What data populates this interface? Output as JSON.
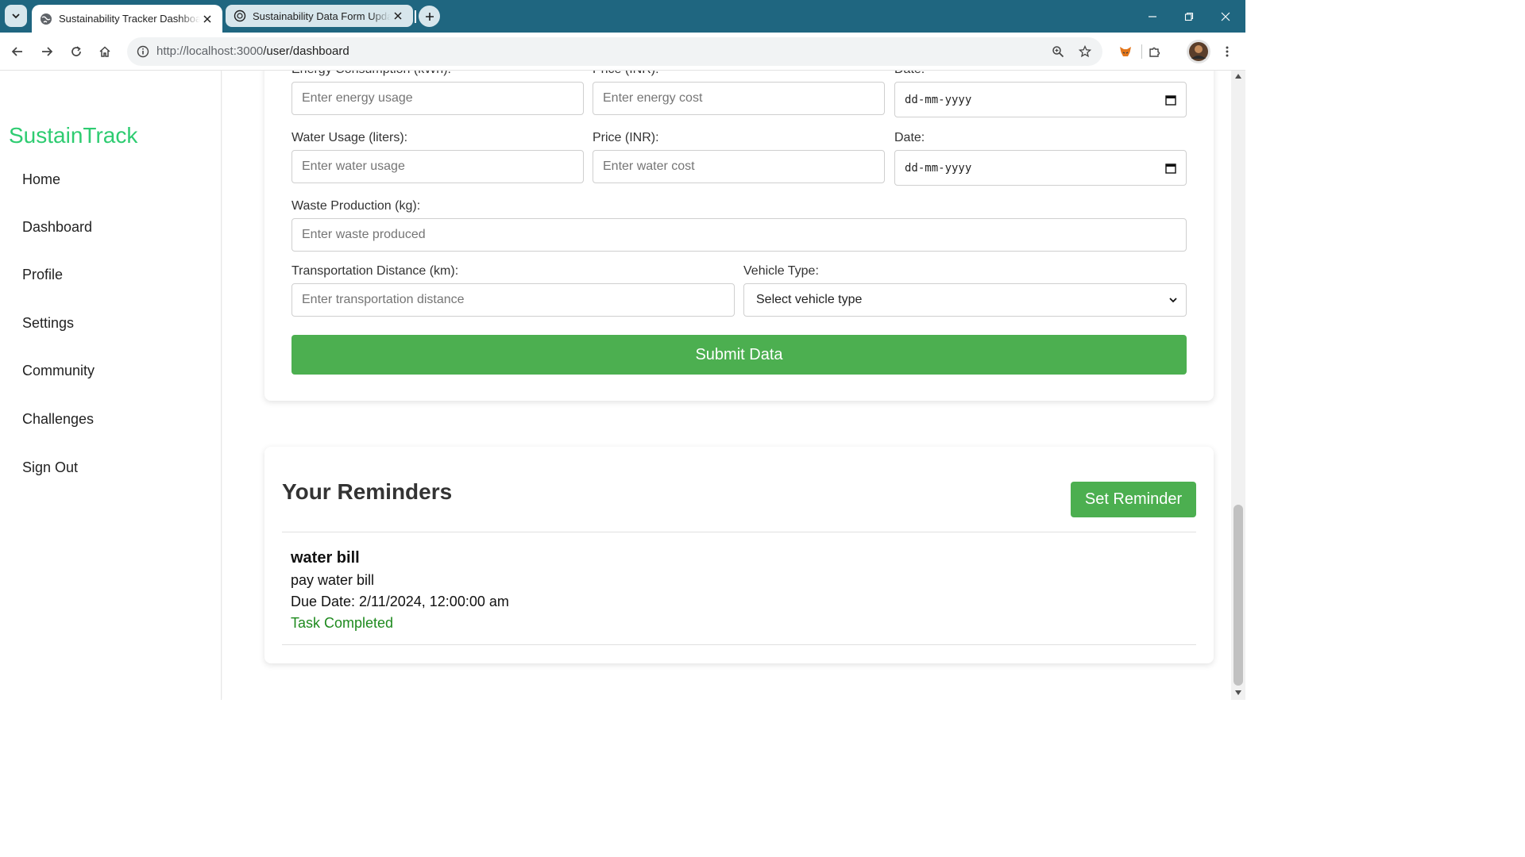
{
  "browser": {
    "tabs": [
      {
        "title": "Sustainability Tracker Dashboard",
        "active": true
      },
      {
        "title": "Sustainability Data Form Update",
        "active": false
      }
    ],
    "url_host": "http://localhost:3000",
    "url_path": "/user/dashboard"
  },
  "sidebar": {
    "brand": "SustainTrack",
    "brand_color": "#2ecc71",
    "items": [
      {
        "label": "Home"
      },
      {
        "label": "Dashboard"
      },
      {
        "label": "Profile"
      },
      {
        "label": "Settings"
      },
      {
        "label": "Community"
      },
      {
        "label": "Challenges"
      },
      {
        "label": "Sign Out"
      }
    ]
  },
  "form": {
    "energy": {
      "label": "Energy Consumption (kWh):",
      "placeholder": "Enter energy usage",
      "price_label": "Price (INR):",
      "price_placeholder": "Enter energy cost",
      "date_label": "Date:",
      "date_value": "dd-mm-yyyy"
    },
    "water": {
      "label": "Water Usage (liters):",
      "placeholder": "Enter water usage",
      "price_label": "Price (INR):",
      "price_placeholder": "Enter water cost",
      "date_label": "Date:",
      "date_value": "dd-mm-yyyy"
    },
    "waste": {
      "label": "Waste Production (kg):",
      "placeholder": "Enter waste produced"
    },
    "transport": {
      "label": "Transportation Distance (km):",
      "placeholder": "Enter transportation distance",
      "vehicle_label": "Vehicle Type:",
      "vehicle_selected": "Select vehicle type"
    },
    "submit_label": "Submit Data",
    "accent_color": "#4caf50"
  },
  "reminders": {
    "title": "Your Reminders",
    "set_button": "Set Reminder",
    "items": [
      {
        "title": "water bill",
        "description": "pay water bill",
        "due": "Due Date: 2/11/2024, 12:00:00 am",
        "status": "Task Completed"
      }
    ]
  }
}
